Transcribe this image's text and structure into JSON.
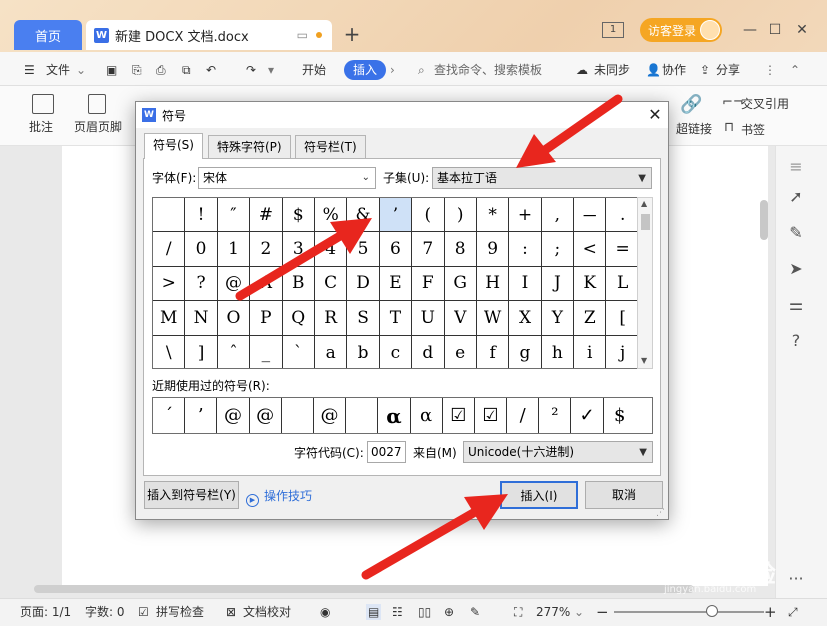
{
  "tabs": {
    "home": "首页",
    "doc": "新建 DOCX 文档.docx"
  },
  "titlebar": {
    "window_count": "1",
    "login": "访客登录"
  },
  "menubar": {
    "file": "文件",
    "start": "开始",
    "insert": "插入",
    "search_placeholder": "查找命令、搜索模板",
    "unsynced": "未同步",
    "collab": "协作",
    "share": "分享"
  },
  "ribbon": {
    "comment": "批注",
    "header_footer": "页眉页脚",
    "hyperlink": "超链接",
    "crossref": "交叉引用",
    "bookmark": "书签"
  },
  "dialog": {
    "title": "符号",
    "tabs": [
      "符号(S)",
      "特殊字符(P)",
      "符号栏(T)"
    ],
    "font_label": "字体(F):",
    "font_value": "宋体",
    "subset_label": "子集(U):",
    "subset_value": "基本拉丁语",
    "grid_rows": [
      [
        " ",
        "!",
        "″",
        "#",
        "$",
        "%",
        "&",
        "’",
        "(",
        ")",
        "*",
        "+",
        ",",
        "－",
        "."
      ],
      [
        "/",
        "0",
        "1",
        "2",
        "3",
        "4",
        "5",
        "6",
        "7",
        "8",
        "9",
        ":",
        ";",
        "<",
        "="
      ],
      [
        ">",
        "?",
        "@",
        "A",
        "B",
        "C",
        "D",
        "E",
        "F",
        "G",
        "H",
        "I",
        "J",
        "K",
        "L"
      ],
      [
        "M",
        "N",
        "O",
        "P",
        "Q",
        "R",
        "S",
        "T",
        "U",
        "V",
        "W",
        "X",
        "Y",
        "Z",
        "["
      ],
      [
        "\\",
        "]",
        "ˆ",
        "_",
        "`",
        "a",
        "b",
        "c",
        "d",
        "e",
        "f",
        "g",
        "h",
        "i",
        "j"
      ]
    ],
    "recent_label": "近期使用过的符号(R):",
    "recent_symbols": [
      "´",
      "’",
      "@",
      "@",
      "",
      "@",
      "",
      "α",
      "α",
      "☑",
      "☑",
      "/",
      "²",
      "✓",
      "$"
    ],
    "charcode_label": "字符代码(C):",
    "charcode_value": "0027",
    "from_label": "来自(M)",
    "from_value": "Unicode(十六进制)",
    "add_to_bar": "插入到符号栏(Y)",
    "tips": "操作技巧",
    "insert": "插入(I)",
    "cancel": "取消"
  },
  "statusbar": {
    "page": "页面: 1/1",
    "words": "字数: 0",
    "spellcheck": "拼写检查",
    "proofread": "文档校对",
    "zoom": "277%"
  },
  "watermark": {
    "brand": "Bai du 经验",
    "url": "jingyan.baidu.com"
  },
  "colors": {
    "accent": "#3a72e8",
    "arrow": "#e8261e",
    "selected_cell": "#cfe1f7"
  }
}
